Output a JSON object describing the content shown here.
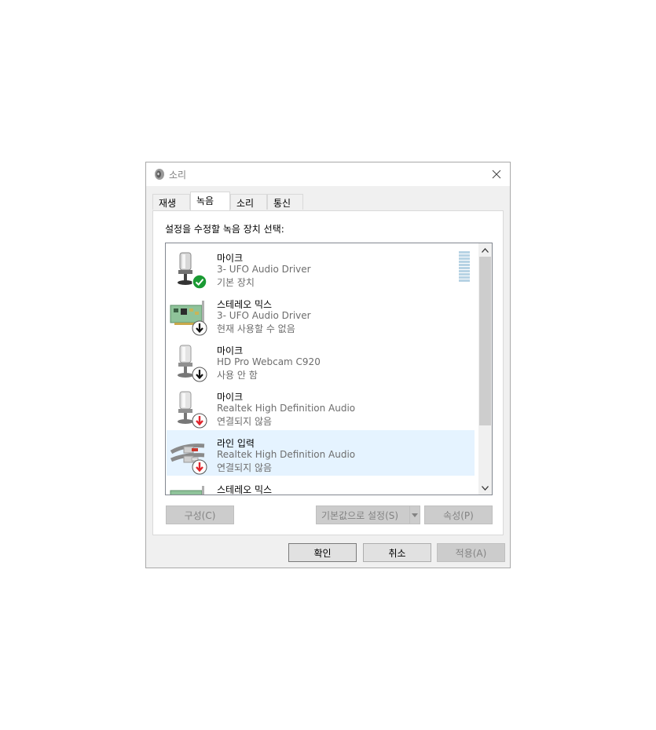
{
  "window": {
    "title": "소리"
  },
  "tabs": [
    {
      "label": "재생"
    },
    {
      "label": "녹음"
    },
    {
      "label": "소리"
    },
    {
      "label": "통신"
    }
  ],
  "instruction": "설정을 수정할 녹음 장치 선택:",
  "devices": [
    {
      "name": "마이크",
      "driver": "3- UFO Audio Driver",
      "status": "기본 장치",
      "icon": "microphone-icon",
      "badge": "check-badge-icon"
    },
    {
      "name": "스테레오 믹스",
      "driver": "3- UFO Audio Driver",
      "status": "현재 사용할 수 없음",
      "icon": "sound-card-icon",
      "badge": "down-arrow-badge-icon"
    },
    {
      "name": "마이크",
      "driver": "HD Pro Webcam C920",
      "status": "사용 안 함",
      "icon": "microphone-icon",
      "badge": "down-arrow-badge-icon"
    },
    {
      "name": "마이크",
      "driver": "Realtek High Definition Audio",
      "status": "연결되지 않음",
      "icon": "microphone-icon",
      "badge": "red-down-arrow-badge-icon"
    },
    {
      "name": "라인 입력",
      "driver": "Realtek High Definition Audio",
      "status": "연결되지 않음",
      "icon": "line-in-cable-icon",
      "badge": "red-down-arrow-badge-icon"
    },
    {
      "name": "스테레오 믹스",
      "driver": "",
      "status": "",
      "icon": "sound-card-icon",
      "badge": ""
    }
  ],
  "buttons": {
    "configure": "구성(C)",
    "set_default": "기본값으로 설정(S)",
    "properties": "속성(P)",
    "ok": "확인",
    "cancel": "취소",
    "apply": "적용(A)"
  },
  "colors": {
    "selected_row": "#e5f3ff",
    "check_green": "#1a9a33",
    "arrow_red": "#e0242b"
  }
}
